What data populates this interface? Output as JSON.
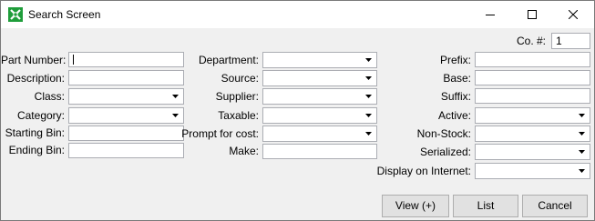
{
  "window": {
    "title": "Search Screen",
    "app_icon": "app-x-icon"
  },
  "company": {
    "label": "Co. #:",
    "value": "1"
  },
  "col1": {
    "part_number": {
      "label": "Part Number:",
      "value": ""
    },
    "description": {
      "label": "Description:",
      "value": ""
    },
    "class": {
      "label": "Class:",
      "value": ""
    },
    "category": {
      "label": "Category:",
      "value": ""
    },
    "starting_bin": {
      "label": "Starting Bin:",
      "value": ""
    },
    "ending_bin": {
      "label": "Ending Bin:",
      "value": ""
    }
  },
  "col2": {
    "department": {
      "label": "Department:",
      "value": ""
    },
    "source": {
      "label": "Source:",
      "value": ""
    },
    "supplier": {
      "label": "Supplier:",
      "value": ""
    },
    "taxable": {
      "label": "Taxable:",
      "value": ""
    },
    "prompt_for_cost": {
      "label": "Prompt for cost:",
      "value": ""
    },
    "make": {
      "label": "Make:",
      "value": ""
    }
  },
  "col3": {
    "prefix": {
      "label": "Prefix:",
      "value": ""
    },
    "base": {
      "label": "Base:",
      "value": ""
    },
    "suffix": {
      "label": "Suffix:",
      "value": ""
    },
    "active": {
      "label": "Active:",
      "value": ""
    },
    "non_stock": {
      "label": "Non-Stock:",
      "value": ""
    },
    "serialized": {
      "label": "Serialized:",
      "value": ""
    },
    "display_on_internet": {
      "label": "Display on Internet:",
      "value": ""
    }
  },
  "buttons": {
    "view": "View (+)",
    "list": "List",
    "cancel": "Cancel"
  },
  "colors": {
    "titlebar": "#ffffff",
    "client": "#f0f0f0",
    "field_border": "#abadb3",
    "button_bg": "#e1e1e1",
    "icon_green": "#1f9d3a"
  }
}
